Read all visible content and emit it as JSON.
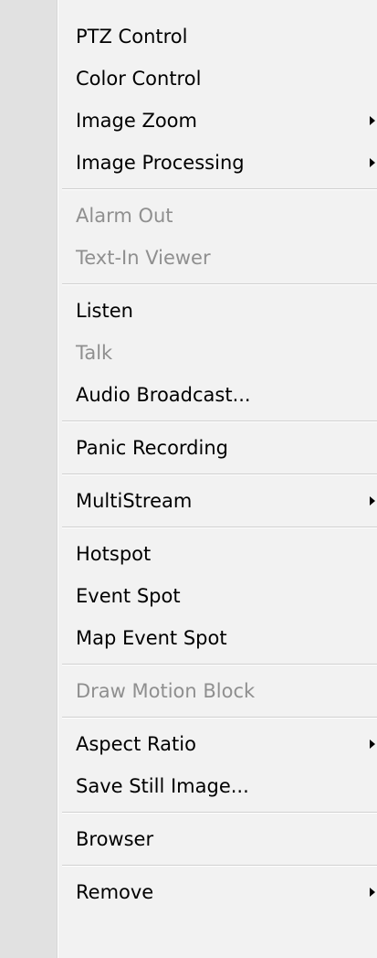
{
  "menu": {
    "items": [
      {
        "label": "PTZ Control"
      },
      {
        "label": "Color Control"
      },
      {
        "label": "Image Zoom",
        "submenu_icon": "triangle-right-icon"
      },
      {
        "label": "Image Processing",
        "submenu_icon": "triangle-right-icon"
      },
      {
        "label": "Alarm Out",
        "state": "disabled"
      },
      {
        "label": "Text-In Viewer",
        "state": "disabled"
      },
      {
        "label": "Listen"
      },
      {
        "label": "Talk",
        "state": "disabled"
      },
      {
        "label": "Audio Broadcast..."
      },
      {
        "label": "Panic Recording"
      },
      {
        "label": "MultiStream",
        "submenu_icon": "triangle-right-icon"
      },
      {
        "label": "Hotspot"
      },
      {
        "label": "Event Spot"
      },
      {
        "label": "Map Event Spot"
      },
      {
        "label": "Draw Motion Block",
        "state": "disabled"
      },
      {
        "label": "Aspect Ratio",
        "submenu_icon": "triangle-right-icon"
      },
      {
        "label": "Save Still Image..."
      },
      {
        "label": "Browser"
      },
      {
        "label": "Remove",
        "submenu_icon": "triangle-right-icon"
      }
    ]
  },
  "colors": {
    "background": "#f2f2f2",
    "gutter": "#e1e1e1",
    "text": "#000000",
    "disabled_text": "#8f8f8f",
    "separator": "#d0d0d0"
  }
}
